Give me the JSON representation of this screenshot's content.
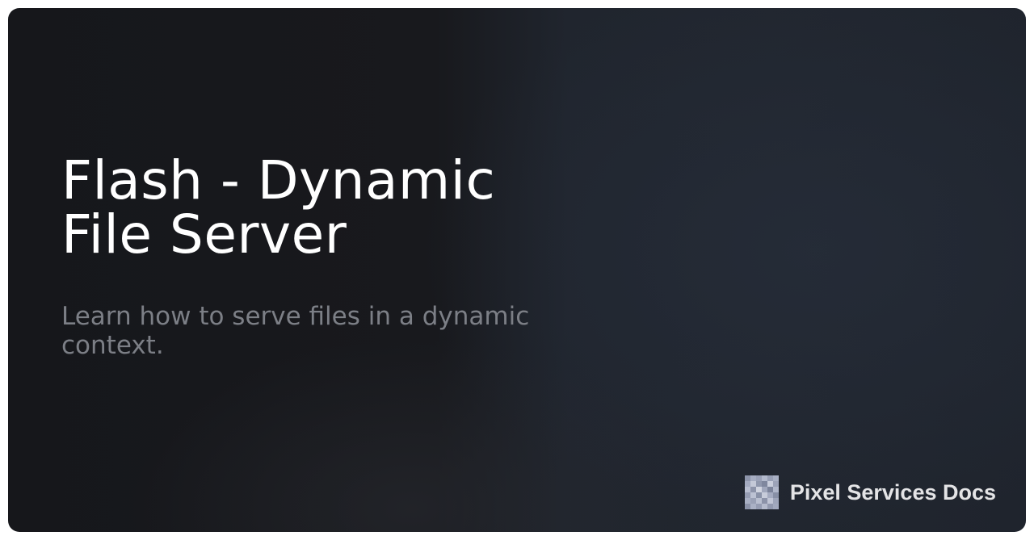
{
  "page": {
    "title": "Flash - Dynamic File Server",
    "description": "Learn how to serve files in a dynamic context."
  },
  "brand": {
    "name": "Pixel Services Docs",
    "logo_icon": "pixel-logo-icon"
  },
  "colors": {
    "background": "#1a1c21",
    "title": "#ffffff",
    "description": "#7c7f86",
    "brand_text": "#e4e4e6"
  }
}
